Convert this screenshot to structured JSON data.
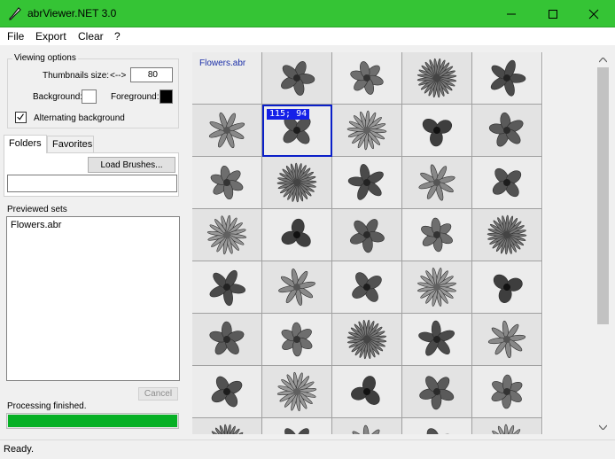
{
  "window": {
    "title": "abrViewer.NET 3.0"
  },
  "menu": [
    "File",
    "Export",
    "Clear",
    "?"
  ],
  "viewing_options": {
    "legend": "Viewing options",
    "thumb_size_label": "Thumbnails size:",
    "thumb_size_arrows": "<-->",
    "thumb_size_value": "80",
    "background_label": "Background:",
    "foreground_label": "Foreground:",
    "background_color": "#ffffff",
    "foreground_color": "#000000",
    "alternating_label": "Alternating background",
    "alternating_checked": true
  },
  "tabs": {
    "folders": "Folders",
    "favorites": "Favorites",
    "active": "Folders"
  },
  "folders_tab": {
    "load_button": "Load Brushes...",
    "path_value": ""
  },
  "previewed_sets": {
    "label": "Previewed sets",
    "items": [
      "Flowers.abr"
    ]
  },
  "cancel_button": "Cancel",
  "processing": {
    "label": "Processing finished.",
    "progress": 1.0
  },
  "status": "Ready.",
  "viewer": {
    "set_name": "Flowers.abr",
    "selected_badge": "115; 94",
    "columns": 5
  },
  "colors": {
    "titlebar": "#35c435",
    "progress": "#06b025",
    "selection": "#0a1fc8",
    "set_name": "#1a2ea8"
  }
}
